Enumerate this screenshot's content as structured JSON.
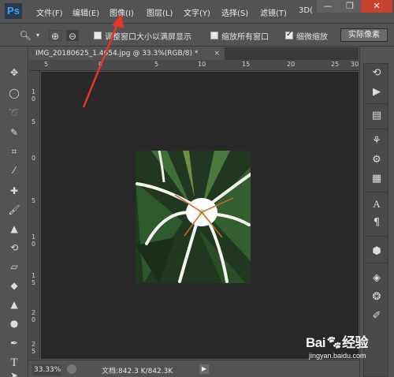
{
  "app": {
    "logo": "Ps",
    "menu": [
      "文件(F)",
      "编辑(E)",
      "图像(I)",
      "图层(L)",
      "文字(Y)",
      "选择(S)",
      "滤镜(T)",
      "3D("
    ],
    "window_controls": [
      "—",
      "❐",
      "✕"
    ]
  },
  "options_bar": {
    "tool_icon": "zoom-icon",
    "zoom_in_icon": "zoom-in-icon",
    "zoom_out_icon": "zoom-out-icon",
    "resize_window_label": "调整窗口大小以满屏显示",
    "resize_window_checked": false,
    "zoom_all_label": "缩放所有窗口",
    "zoom_all_checked": false,
    "scrubby_label": "细微缩放",
    "scrubby_checked": true,
    "actual_pixels_label": "实际像素"
  },
  "document": {
    "tab_title": "IMG_20180625_1.4654.jpg @ 33.3%(RGB/8) *",
    "tab_close": "×",
    "ruler_top_labels": [
      "5",
      "0",
      "5",
      "10",
      "15",
      "20",
      "25",
      "30"
    ],
    "ruler_left_labels": [
      "1\n0",
      "5",
      "0",
      "5",
      "1\n0",
      "1\n5",
      "2\n0",
      "2\n5",
      "3\n0"
    ]
  },
  "status": {
    "zoom": "33.33%",
    "doc_info": "文档:842.3 K/842.3K",
    "arrow": "▶"
  },
  "toolbox": [
    "move-icon",
    "marquee-icon",
    "lasso-icon",
    "quick-select-icon",
    "crop-icon",
    "eyedropper-icon",
    "healing-icon",
    "brush-icon",
    "stamp-icon",
    "history-brush-icon",
    "eraser-icon",
    "gradient-icon",
    "blur-icon",
    "dodge-icon",
    "pen-icon",
    "text-icon",
    "path-select-icon"
  ],
  "watermark": {
    "brand": "Bai",
    "brand_suffix": "经验",
    "url": "jingyan.baidu.com"
  },
  "colors": {
    "annotation": "#e8352a",
    "canvas": "#282828",
    "ui": "#535353"
  }
}
